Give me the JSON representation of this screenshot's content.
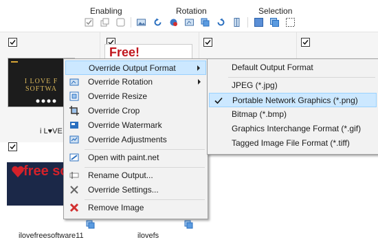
{
  "toolbar": {
    "groups": [
      {
        "label": "Enabling"
      },
      {
        "label": "Rotation"
      },
      {
        "label": "Selection"
      }
    ]
  },
  "gallery": {
    "items": [
      {
        "caption": "i L♥VE",
        "checked": true,
        "thumb_text": "I LOVE F SOFTWA"
      },
      {
        "caption": "",
        "checked": true,
        "thumb_text": "Free!"
      },
      {
        "caption": "",
        "checked": true
      },
      {
        "caption": "",
        "checked": true
      },
      {
        "caption": "ilovefreesoftware11",
        "checked": true,
        "thumb_text": "free softw"
      },
      {
        "caption": "ilovefs",
        "checked": false
      }
    ]
  },
  "context_menu": {
    "items": [
      {
        "label": "Override Output Format",
        "icon": "format-icon",
        "has_submenu": true,
        "highlighted": true
      },
      {
        "label": "Override Rotation",
        "icon": "rotation-icon",
        "has_submenu": true
      },
      {
        "label": "Override Resize",
        "icon": "resize-icon"
      },
      {
        "label": "Override Crop",
        "icon": "crop-icon"
      },
      {
        "label": "Override Watermark",
        "icon": "watermark-icon"
      },
      {
        "label": "Override Adjustments",
        "icon": "adjustments-icon"
      },
      {
        "label": "Open with paint.net",
        "icon": "paintnet-icon"
      },
      {
        "label": "Rename Output...",
        "icon": "rename-icon"
      },
      {
        "label": "Override Settings...",
        "icon": "settings-icon"
      },
      {
        "label": "Remove Image",
        "icon": "remove-icon"
      }
    ]
  },
  "format_submenu": {
    "items": [
      {
        "label": "Default Output Format",
        "checked": false
      },
      {
        "label": "JPEG (*.jpg)",
        "checked": false
      },
      {
        "label": "Portable Network Graphics (*.png)",
        "checked": true
      },
      {
        "label": "Bitmap (*.bmp)",
        "checked": false
      },
      {
        "label": "Graphics Interchange Format (*.gif)",
        "checked": false
      },
      {
        "label": "Tagged Image File Format (*.tiff)",
        "checked": false
      }
    ]
  },
  "colors": {
    "highlight": "#cce8ff",
    "highlight_border": "#99d1ff",
    "menu_bg": "#f2f2f2",
    "accent_blue": "#2a6fbf",
    "remove_red": "#d22f2f"
  }
}
